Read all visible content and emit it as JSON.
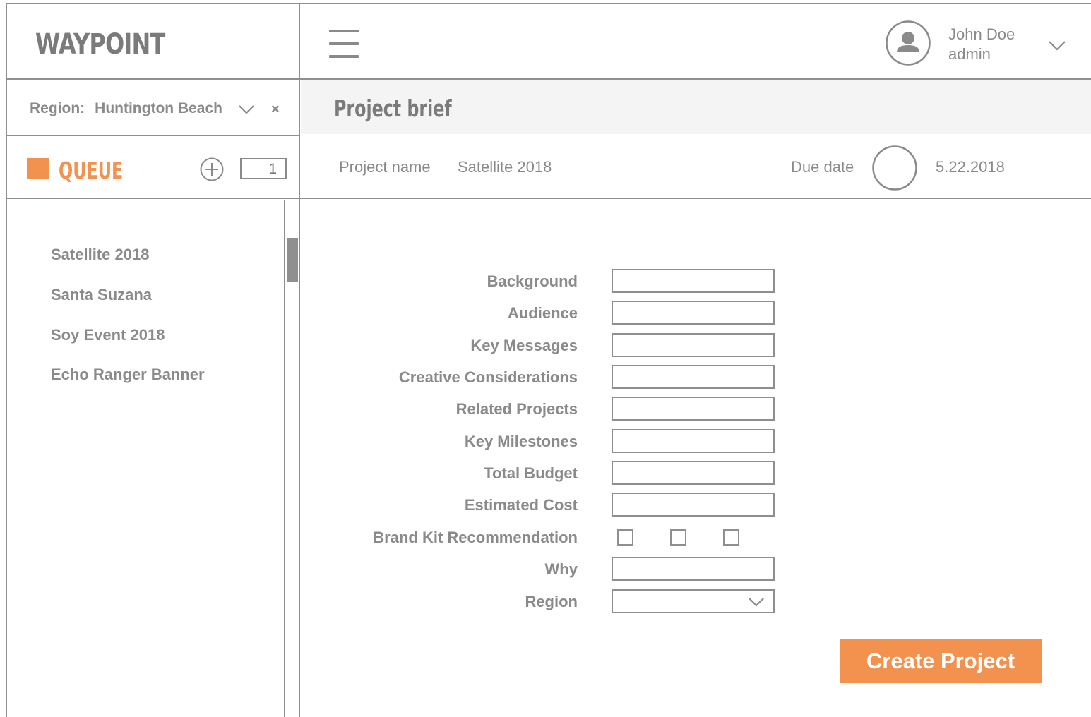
{
  "app": {
    "logo": "WAYPOINT"
  },
  "sidebar": {
    "region": {
      "label": "Region:",
      "value": "Huntington Beach"
    },
    "queue": {
      "label": "QUEUE",
      "count": "1",
      "items": [
        "Satellite 2018",
        "Santa Suzana",
        "Soy Event 2018",
        "Echo Ranger Banner"
      ]
    }
  },
  "header": {
    "user": {
      "name": "John Doe",
      "role": "admin"
    }
  },
  "page": {
    "title": "Project brief",
    "project_name_label": "Project name",
    "project_name_value": "Satellite 2018",
    "due_date_label": "Due date",
    "due_date_value": "5.22.2018"
  },
  "form": {
    "fields": [
      {
        "label": "Background",
        "value": ""
      },
      {
        "label": "Audience",
        "value": ""
      },
      {
        "label": "Key Messages",
        "value": ""
      },
      {
        "label": "Creative Considerations",
        "value": ""
      },
      {
        "label": "Related Projects",
        "value": ""
      },
      {
        "label": "Key Milestones",
        "value": ""
      },
      {
        "label": "Total Budget",
        "value": ""
      },
      {
        "label": "Estimated Cost",
        "value": ""
      }
    ],
    "brand_kit_label": "Brand Kit Recommendation",
    "brand_kit_checked": [
      false,
      false,
      false
    ],
    "why": {
      "label": "Why",
      "value": ""
    },
    "region": {
      "label": "Region",
      "value": ""
    },
    "submit_label": "Create Project"
  },
  "colors": {
    "accent": "#f3914e",
    "line": "#8f8f8f",
    "text": "#8a8a8a",
    "title_bar": "#f4f4f4"
  }
}
